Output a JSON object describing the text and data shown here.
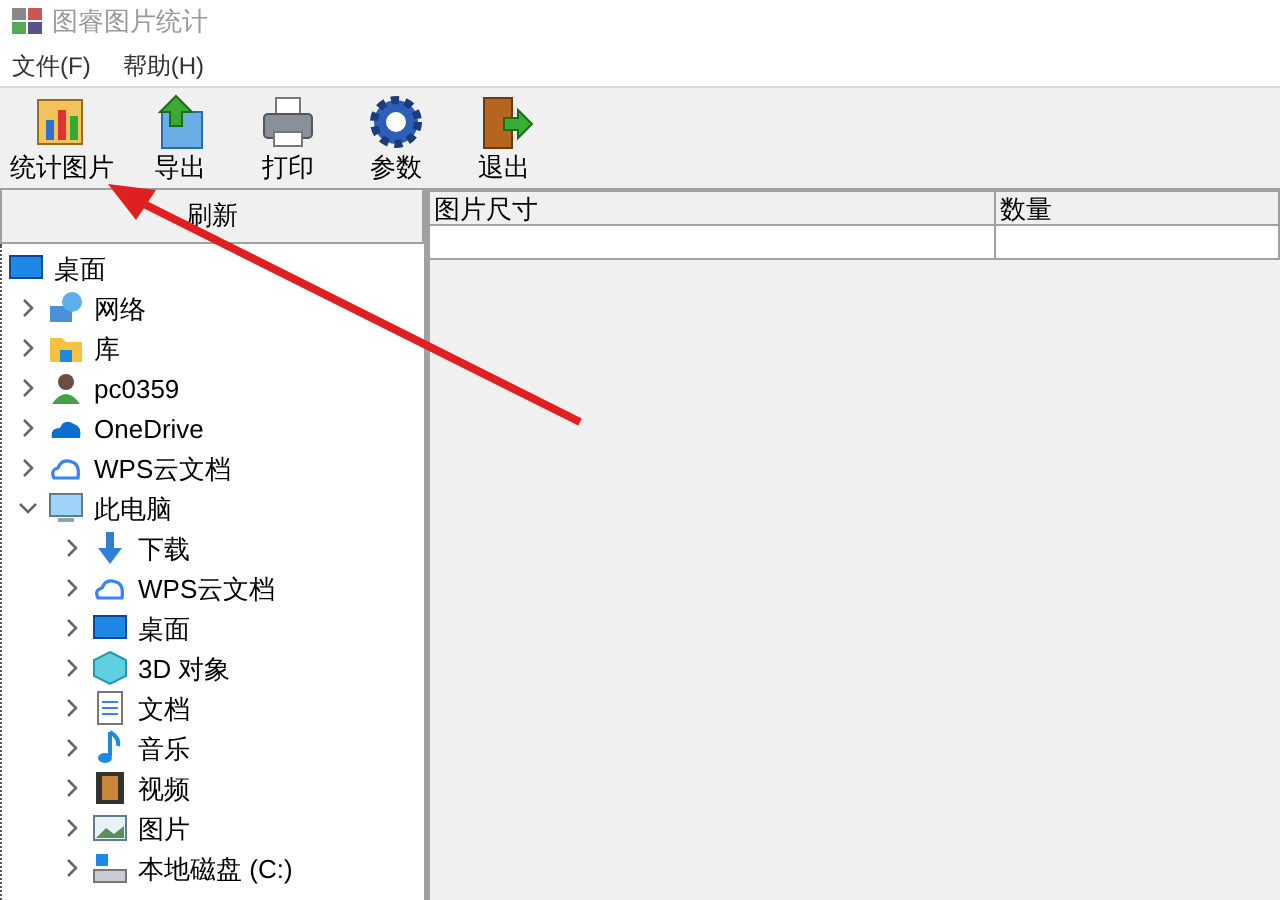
{
  "window": {
    "title": "图睿图片统计"
  },
  "menu": [
    {
      "label": "文件(F)"
    },
    {
      "label": "帮助(H)"
    }
  ],
  "toolbar": [
    {
      "label": "统计图片",
      "kind": "stats"
    },
    {
      "label": "导出",
      "kind": "export"
    },
    {
      "label": "打印",
      "kind": "print"
    },
    {
      "label": "参数",
      "kind": "settings"
    },
    {
      "label": "退出",
      "kind": "exit"
    }
  ],
  "refresh_button": {
    "label": "刷新"
  },
  "tree": [
    {
      "label": "桌面",
      "kind": "desktop",
      "children": [
        {
          "label": "网络",
          "kind": "network",
          "expanded": false
        },
        {
          "label": "库",
          "kind": "library",
          "expanded": false
        },
        {
          "label": "pc0359",
          "kind": "user",
          "expanded": false
        },
        {
          "label": "OneDrive",
          "kind": "onedrive",
          "expanded": false
        },
        {
          "label": "WPS云文档",
          "kind": "cloud",
          "expanded": false
        },
        {
          "label": "此电脑",
          "kind": "computer",
          "expanded": true,
          "children": [
            {
              "label": "下载",
              "kind": "download",
              "expanded": false
            },
            {
              "label": "WPS云文档",
              "kind": "cloud",
              "expanded": false
            },
            {
              "label": "桌面",
              "kind": "desktop",
              "expanded": false
            },
            {
              "label": "3D 对象",
              "kind": "cube",
              "expanded": false
            },
            {
              "label": "文档",
              "kind": "document",
              "expanded": false
            },
            {
              "label": "音乐",
              "kind": "music",
              "expanded": false
            },
            {
              "label": "视频",
              "kind": "video",
              "expanded": false
            },
            {
              "label": "图片",
              "kind": "picture",
              "expanded": false
            },
            {
              "label": "本地磁盘 (C:)",
              "kind": "drive",
              "expanded": false
            }
          ]
        }
      ]
    }
  ],
  "table": {
    "columns": [
      "图片尺寸",
      "数量"
    ]
  }
}
